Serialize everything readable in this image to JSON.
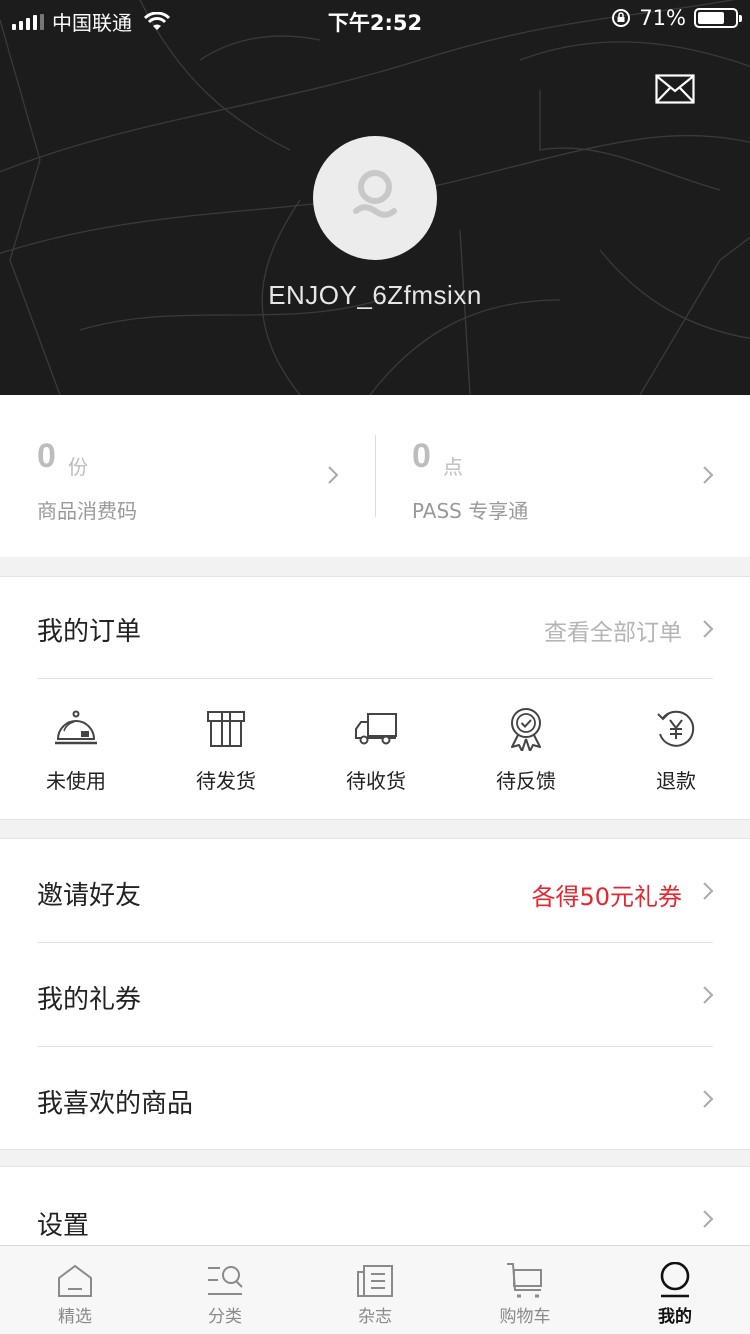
{
  "status_bar": {
    "carrier": "中国联通",
    "time": "下午2:52",
    "battery": "71%",
    "battery_level": 0.71
  },
  "profile": {
    "username": "ENJOY_6Zfmsixn",
    "avatar_icon": "user-avatar-icon",
    "message_icon": "mail-icon"
  },
  "stats": [
    {
      "value": "0",
      "unit": "份",
      "label": "商品消费码"
    },
    {
      "value": "0",
      "unit": "点",
      "label": "PASS 专享通"
    }
  ],
  "orders": {
    "title": "我的订单",
    "view_all": "查看全部订单",
    "items": [
      {
        "label": "未使用",
        "icon": "cloche-icon"
      },
      {
        "label": "待发货",
        "icon": "gift-box-icon"
      },
      {
        "label": "待收货",
        "icon": "truck-icon"
      },
      {
        "label": "待反馈",
        "icon": "badge-icon"
      },
      {
        "label": "退款",
        "icon": "refund-yen-icon"
      }
    ]
  },
  "menu": [
    {
      "label": "邀请好友",
      "extra": "各得50元礼券"
    },
    {
      "label": "我的礼券",
      "extra": ""
    },
    {
      "label": "我喜欢的商品",
      "extra": ""
    }
  ],
  "settings": {
    "label": "设置"
  },
  "tabbar": [
    {
      "label": "精选",
      "icon": "home-icon",
      "active": false
    },
    {
      "label": "分类",
      "icon": "category-search-icon",
      "active": false
    },
    {
      "label": "杂志",
      "icon": "magazine-icon",
      "active": false
    },
    {
      "label": "购物车",
      "icon": "cart-icon",
      "active": false
    },
    {
      "label": "我的",
      "icon": "profile-icon",
      "active": true
    }
  ],
  "colors": {
    "accent": "#e8262f",
    "header_bg": "#1c1c1c"
  }
}
